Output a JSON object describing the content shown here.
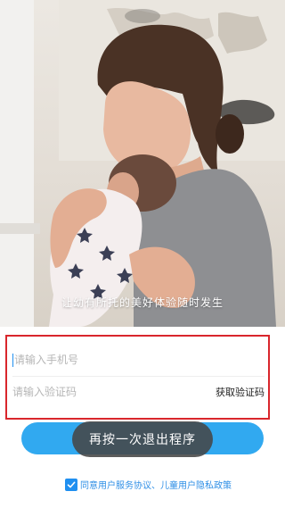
{
  "hero": {
    "caption": "让幼有所托的美好体验随时发生"
  },
  "form": {
    "phone_placeholder": "请输入手机号",
    "code_placeholder": "请输入验证码",
    "get_code_label": "获取验证码"
  },
  "toast": {
    "text": "再按一次退出程序"
  },
  "agreement": {
    "checked": true,
    "text": "同意用户服务协议、儿童用户隐私政策"
  },
  "colors": {
    "accent": "#31a9f0",
    "highlight_border": "#d9262c",
    "agreement_text": "#2f8fe6"
  }
}
